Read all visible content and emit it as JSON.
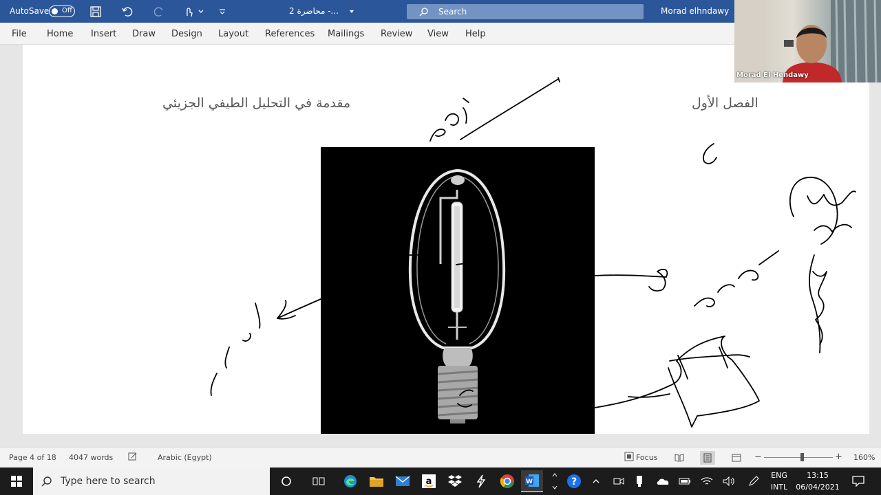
{
  "titlebar": {
    "autosave_label": "AutoSave",
    "autosave_state": "Off",
    "document_title": "محاضرة 2  -...",
    "search_placeholder": "Search",
    "user_name": "Morad elhndawy"
  },
  "ribbon": {
    "tabs": [
      "File",
      "Home",
      "Insert",
      "Draw",
      "Design",
      "Layout",
      "References",
      "Mailings",
      "Review",
      "View",
      "Help"
    ]
  },
  "document": {
    "header_right": "الفصل الأول",
    "header_left": "مقدمة في التحليل الطيفي الجزيئي"
  },
  "webcam": {
    "participant_name": "Morad El Hendawy"
  },
  "statusbar": {
    "page_info": "Page 4 of 18",
    "word_count": "4047 words",
    "language": "Arabic (Egypt)",
    "focus_label": "Focus",
    "zoom_level": "160%"
  },
  "taskbar": {
    "search_placeholder": "Type here to search",
    "language_top": "ENG",
    "language_bottom": "INTL",
    "time": "13:15",
    "date": "06/04/2021"
  },
  "colors": {
    "title_bar": "#2b579a",
    "ribbon": "#f3f3f3",
    "taskbar": "#1c1c1c"
  }
}
